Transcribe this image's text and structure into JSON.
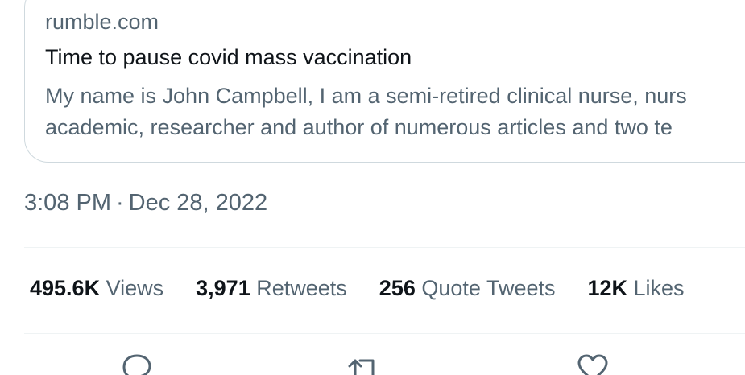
{
  "link_card": {
    "domain": "rumble.com",
    "title": "Time to pause covid mass vaccination",
    "description_line1": "My name is John Campbell, I am a semi-retired clinical nurse, nurs",
    "description_line2": "academic, researcher and author of numerous articles and two te"
  },
  "tweet": {
    "time": "3:08 PM",
    "separator": "·",
    "date": "Dec 28, 2022"
  },
  "stats": [
    {
      "value": "495.6K",
      "label": "Views"
    },
    {
      "value": "3,971",
      "label": "Retweets"
    },
    {
      "value": "256",
      "label": "Quote Tweets"
    },
    {
      "value": "12K",
      "label": "Likes"
    }
  ],
  "actions": [
    {
      "icon": "reply-icon"
    },
    {
      "icon": "retweet-icon"
    },
    {
      "icon": "like-icon"
    }
  ],
  "colors": {
    "primary_text": "#0f1419",
    "secondary_text": "#536471",
    "border": "#cfd9de",
    "divider": "#eff3f4"
  }
}
